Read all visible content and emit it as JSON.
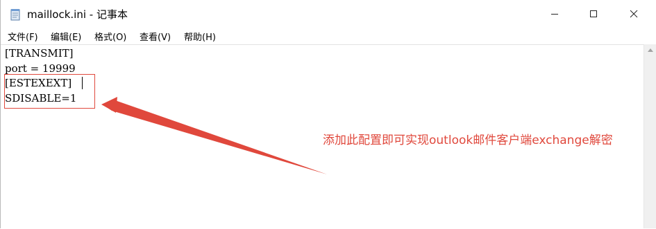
{
  "window": {
    "title": "maillock.ini - 记事本",
    "controls": {
      "minimize": "—",
      "maximize": "☐",
      "close": "✕"
    }
  },
  "menu": {
    "items": [
      {
        "label": "文件(F)"
      },
      {
        "label": "编辑(E)"
      },
      {
        "label": "格式(O)"
      },
      {
        "label": "查看(V)"
      },
      {
        "label": "帮助(H)"
      }
    ]
  },
  "editor": {
    "lines": [
      "[TRANSMIT]",
      "port = 19999",
      "[ESTEXEXT]",
      "SDISABLE=1"
    ]
  },
  "annotation": {
    "text": "添加此配置即可实现outlook邮件客户端exchange解密",
    "color": "#e0483c"
  },
  "icons": {
    "app": "notepad-icon",
    "scroll_up": "scroll-up-arrow-icon"
  }
}
